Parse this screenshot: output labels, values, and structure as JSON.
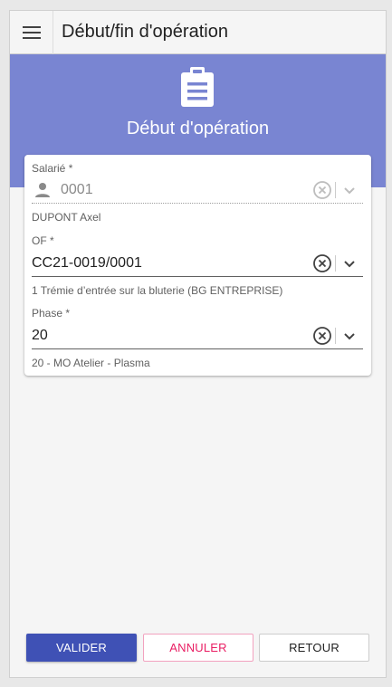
{
  "app_bar": {
    "title": "Début/fin d'opération"
  },
  "banner": {
    "icon": "clipboard-icon",
    "title": "Début d'opération",
    "color": "#7985d2"
  },
  "form": {
    "salarie": {
      "label": "Salarié *",
      "value": "0001",
      "hint": "DUPONT Axel",
      "disabled": true
    },
    "of": {
      "label": "OF *",
      "value": "CC21-0019/0001",
      "hint": "1 Trémie d’entrée sur la bluterie (BG ENTREPRISE)"
    },
    "phase": {
      "label": "Phase *",
      "value": "20",
      "hint": "20 - MO Atelier - Plasma"
    }
  },
  "actions": {
    "valider": "VALIDER",
    "annuler": "ANNULER",
    "retour": "RETOUR"
  },
  "colors": {
    "primary": "#3f51b5",
    "accent": "#e91e63"
  }
}
